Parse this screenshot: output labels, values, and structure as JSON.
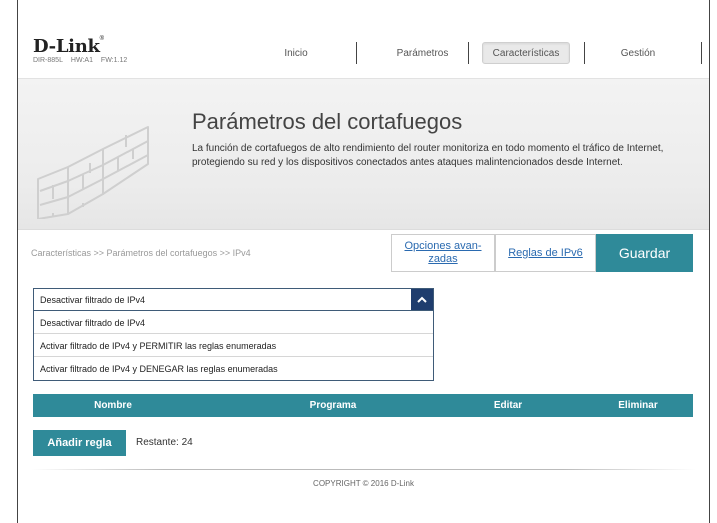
{
  "header": {
    "logo": "D-Link",
    "model": "DIR-885L",
    "hw": "HW:A1",
    "fw": "FW:1.12",
    "nav": [
      {
        "label": "Inicio"
      },
      {
        "label": "Parámetros"
      },
      {
        "label": "Características",
        "active": true
      },
      {
        "label": "Gestión"
      }
    ]
  },
  "banner": {
    "title": "Parámetros del cortafuegos",
    "description": "La función de cortafuegos de alto rendimiento del router monitoriza en todo momento el tráfico de Internet, protegiendo su red y los dispositivos conectados antes ataques malintencionados desde Internet."
  },
  "breadcrumb": "Características >> Parámetros del cortafuegos >> IPv4",
  "links": {
    "advanced_line1": "Opciones avan-",
    "advanced_line2": "zadas",
    "ipv6": "Reglas de IPv6",
    "save": "Guardar"
  },
  "filter": {
    "selected": "Desactivar filtrado de IPv4",
    "options": [
      "Desactivar filtrado de IPv4",
      "Activar filtrado de IPv4 y PERMITIR las reglas enumeradas",
      "Activar filtrado de IPv4 y DENEGAR las reglas enumeradas"
    ]
  },
  "table": {
    "columns": [
      "Nombre",
      "Programa",
      "Editar",
      "Eliminar"
    ]
  },
  "rules": {
    "add_label": "Añadir regla",
    "remaining": "Restante: 24"
  },
  "footer": {
    "copyright": "COPYRIGHT © 2016 D-Link"
  },
  "colors": {
    "accent": "#2f8a99",
    "dropdown_caret": "#1f3d6e",
    "link": "#2a6ab0"
  }
}
